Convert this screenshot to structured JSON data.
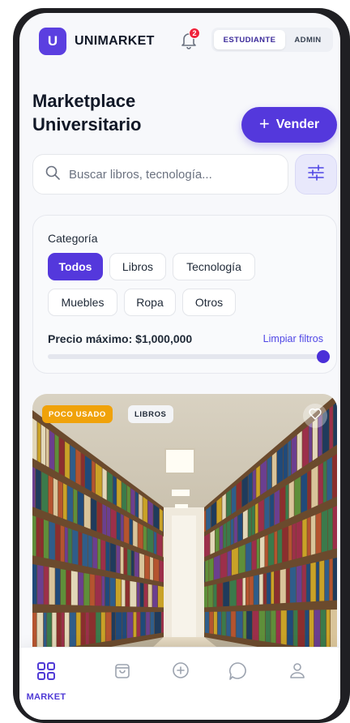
{
  "header": {
    "logo_letter": "U",
    "brand": "UNIMARKET",
    "notification_count": "2",
    "roles": [
      "ESTUDIANTE",
      "ADMIN"
    ],
    "active_role": "ESTUDIANTE"
  },
  "page": {
    "title": "Marketplace Universitario",
    "sell_label": "Vender",
    "sell_icon": "+"
  },
  "search": {
    "placeholder": "Buscar libros, tecnología..."
  },
  "filters": {
    "category_label": "Categoría",
    "categories": [
      "Todos",
      "Libros",
      "Tecnología",
      "Muebles",
      "Ropa",
      "Otros"
    ],
    "selected_category": "Todos",
    "price_label": "Precio máximo: $1,000,000",
    "clear_label": "Limpiar filtros",
    "price_slider_fraction": 1.0
  },
  "product": {
    "condition_badge": "POCO USADO",
    "category_badge": "LIBROS"
  },
  "bottom_nav": {
    "items": [
      {
        "label": "MARKET",
        "icon": "grid-icon",
        "active": true
      },
      {
        "label": "",
        "icon": "bag-icon",
        "active": false
      },
      {
        "label": "",
        "icon": "plus-circle-icon",
        "active": false
      },
      {
        "label": "",
        "icon": "chat-icon",
        "active": false
      },
      {
        "label": "",
        "icon": "user-icon",
        "active": false
      }
    ]
  },
  "colors": {
    "accent": "#5438dc",
    "badge_condition": "#f0a20a",
    "notification": "#ef233c"
  }
}
